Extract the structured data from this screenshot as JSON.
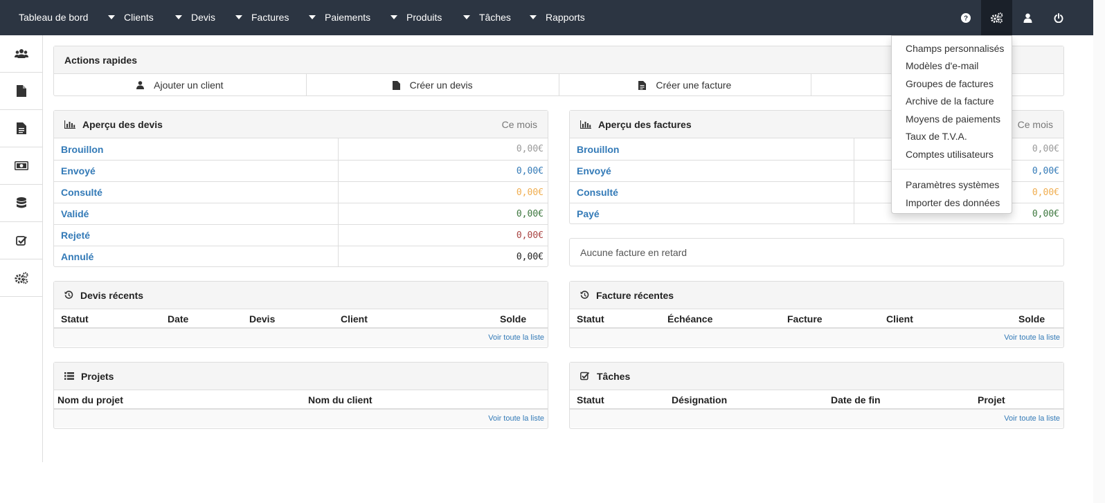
{
  "navbar": {
    "brand": "Tableau de bord",
    "items": [
      "Clients",
      "Devis",
      "Factures",
      "Paiements",
      "Produits",
      "Tâches",
      "Rapports"
    ]
  },
  "quick_actions": {
    "title": "Actions rapides",
    "add_client": "Ajouter un client",
    "create_quote": "Créer un devis",
    "create_invoice": "Créer une facture"
  },
  "quotes_overview": {
    "title": "Aperçu des devis",
    "period": "Ce mois",
    "rows": [
      {
        "label": "Brouillon",
        "value": "0,00€",
        "color": "#999999"
      },
      {
        "label": "Envoyé",
        "value": "0,00€",
        "color": "#337ab7"
      },
      {
        "label": "Consulté",
        "value": "0,00€",
        "color": "#f0ad4e"
      },
      {
        "label": "Validé",
        "value": "0,00€",
        "color": "#3c763d"
      },
      {
        "label": "Rejeté",
        "value": "0,00€",
        "color": "#a94442"
      },
      {
        "label": "Annulé",
        "value": "0,00€",
        "color": "#222222"
      }
    ]
  },
  "invoices_overview": {
    "title": "Aperçu des factures",
    "period": "Ce mois",
    "rows": [
      {
        "label": "Brouillon",
        "value": "0,00€",
        "color": "#999999"
      },
      {
        "label": "Envoyé",
        "value": "0,00€",
        "color": "#337ab7"
      },
      {
        "label": "Consulté",
        "value": "0,00€",
        "color": "#f0ad4e"
      },
      {
        "label": "Payé",
        "value": "0,00€",
        "color": "#3c763d"
      }
    ]
  },
  "overdue": {
    "text": "Aucune facture en retard"
  },
  "recent_quotes": {
    "title": "Devis récents",
    "columns": [
      "Statut",
      "Date",
      "Devis",
      "Client",
      "Solde"
    ],
    "footer": "Voir toute la liste"
  },
  "recent_invoices": {
    "title": "Facture récentes",
    "columns": [
      "Statut",
      "Échéance",
      "Facture",
      "Client",
      "Solde"
    ],
    "footer": "Voir toute la liste"
  },
  "projects": {
    "title": "Projets",
    "columns": [
      "Nom du projet",
      "Nom du client"
    ],
    "footer": "Voir toute la liste"
  },
  "tasks": {
    "title": "Tâches",
    "columns": [
      "Statut",
      "Désignation",
      "Date de fin",
      "Projet"
    ],
    "footer": "Voir toute la liste"
  },
  "settings_menu": {
    "items": [
      "Champs personnalisés",
      "Modèles d'e-mail",
      "Groupes de factures",
      "Archive de la facture",
      "Moyens de paiements",
      "Taux de T.V.A.",
      "Comptes utilisateurs"
    ],
    "system_items": [
      "Paramètres systèmes",
      "Importer des données"
    ]
  },
  "colors": {
    "navbar": "#2c3542",
    "link": "#337ab7"
  }
}
